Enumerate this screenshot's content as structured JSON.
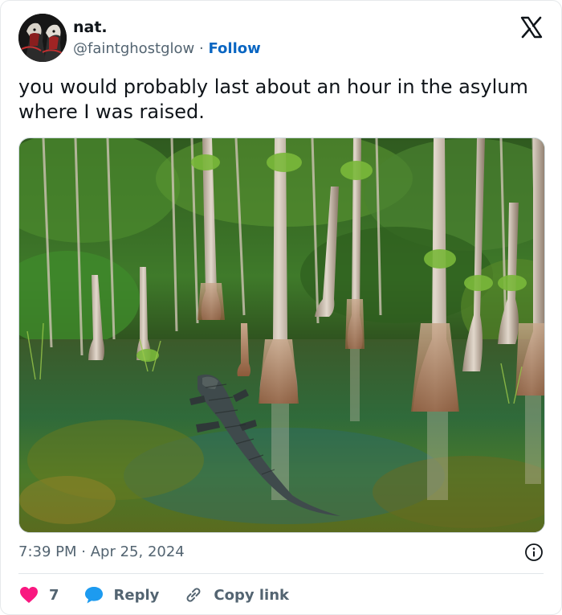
{
  "author": {
    "name": "nat.",
    "handle": "@faintghostglow",
    "separator": "·",
    "follow_label": "Follow"
  },
  "tweet": {
    "text": "you would probably last about an hour in the asylum where I was raised.",
    "time": "7:39 PM",
    "date_separator": "·",
    "date": "Apr 25, 2024"
  },
  "actions": {
    "like_count": "7",
    "reply_label": "Reply",
    "copy_link_label": "Copy link"
  },
  "icons": {
    "logo": "x-logo-icon",
    "info": "info-icon",
    "like": "heart-icon",
    "reply": "speech-bubble-icon",
    "copy_link": "link-icon"
  },
  "colors": {
    "follow": "#0a66c2",
    "like": "#f91880",
    "reply": "#1d9bf0",
    "secondary_text": "#536471"
  }
}
